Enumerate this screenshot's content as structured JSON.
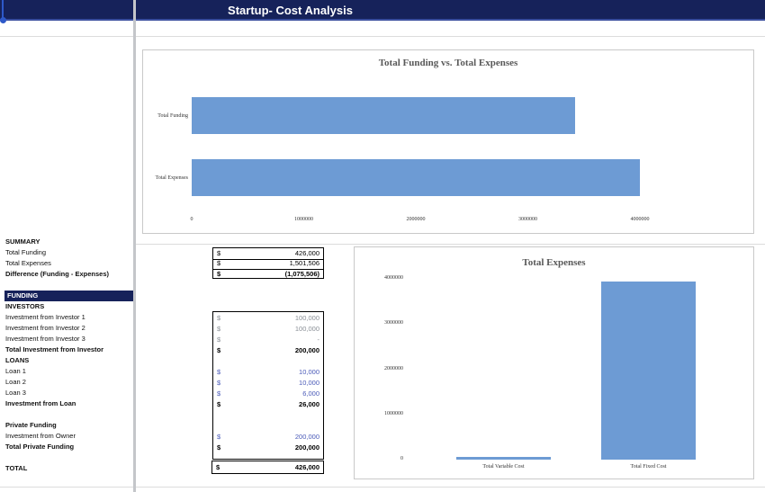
{
  "header": {
    "title": "Startup- Cost Analysis"
  },
  "colors": {
    "navy": "#16225a",
    "accent_line": "#3a4e9d",
    "bar_blue": "#6d9bd4",
    "input_blue": "#4a5ab8",
    "muted_gray": "#8a8f96",
    "chart_title_gray": "#595959",
    "border_gray": "#c9c9c9",
    "selection_blue": "#2e59c9"
  },
  "sidebar": {
    "rows": [
      {
        "label": "SUMMARY",
        "style": "section"
      },
      {
        "label": "Total Funding",
        "style": "item"
      },
      {
        "label": "Total Expenses",
        "style": "item"
      },
      {
        "label": "Difference (Funding - Expenses)",
        "style": "section"
      },
      {
        "label": "",
        "style": "blank"
      },
      {
        "label": "FUNDING",
        "style": "banner"
      },
      {
        "label": "INVESTORS",
        "style": "section"
      },
      {
        "label": "Investment from Investor 1",
        "style": "item"
      },
      {
        "label": "Investment from Investor 2",
        "style": "item"
      },
      {
        "label": "Investment from Investor 3",
        "style": "item"
      },
      {
        "label": "Total Investment from Investor",
        "style": "section"
      },
      {
        "label": "LOANS",
        "style": "section"
      },
      {
        "label": "Loan 1",
        "style": "item"
      },
      {
        "label": "Loan 2",
        "style": "item"
      },
      {
        "label": "Loan 3",
        "style": "item"
      },
      {
        "label": "Investment from Loan",
        "style": "section"
      },
      {
        "label": "",
        "style": "blank"
      },
      {
        "label": "Private Funding",
        "style": "section"
      },
      {
        "label": "Investment from Owner",
        "style": "item"
      },
      {
        "label": "Total Private Funding",
        "style": "section"
      },
      {
        "label": "",
        "style": "blank"
      },
      {
        "label": "TOTAL",
        "style": "section"
      }
    ]
  },
  "summary_box": {
    "rows": [
      {
        "currency": "$",
        "value": "426,000",
        "style": "sep"
      },
      {
        "currency": "$",
        "value": "1,501,506",
        "style": "sep"
      },
      {
        "currency": "$",
        "value": "(1,075,506)",
        "style": "bold topline"
      }
    ]
  },
  "funding_box": {
    "rows": [
      {
        "currency": "$",
        "value": "100,000",
        "style": "gray"
      },
      {
        "currency": "$",
        "value": "100,000",
        "style": "gray"
      },
      {
        "currency": "$",
        "value": "-",
        "style": "gray"
      },
      {
        "currency": "$",
        "value": "200,000",
        "style": "bold"
      },
      {
        "style": "blank"
      },
      {
        "currency": "$",
        "value": "10,000",
        "style": "blue"
      },
      {
        "currency": "$",
        "value": "10,000",
        "style": "blue"
      },
      {
        "currency": "$",
        "value": "6,000",
        "style": "blue"
      },
      {
        "currency": "$",
        "value": "26,000",
        "style": "bold"
      },
      {
        "style": "blank"
      },
      {
        "style": "blank"
      },
      {
        "currency": "$",
        "value": "200,000",
        "style": "blue"
      },
      {
        "currency": "$",
        "value": "200,000",
        "style": "bold"
      },
      {
        "style": "blank"
      }
    ]
  },
  "total_box": {
    "row": {
      "currency": "$",
      "value": "426,000"
    }
  },
  "chart_data": [
    {
      "type": "bar",
      "orientation": "horizontal",
      "title": "Total Funding vs. Total Expenses",
      "categories": [
        "Total Funding",
        "Total Expenses"
      ],
      "values": [
        3420000,
        4000000
      ],
      "xticks": [
        0,
        1000000,
        2000000,
        3000000,
        4000000
      ],
      "xlim": [
        0,
        4700000
      ],
      "grid": false,
      "legend": false,
      "bar_color": "#6d9bd4"
    },
    {
      "type": "bar",
      "orientation": "vertical",
      "title": "Total Expenses",
      "categories": [
        "Total Variable Cost",
        "Total Fixed Cost"
      ],
      "values": [
        60000,
        3950000
      ],
      "yticks": [
        0,
        1000000,
        2000000,
        3000000,
        4000000
      ],
      "ylim": [
        0,
        4200000
      ],
      "grid": false,
      "legend": false,
      "bar_color": "#6d9bd4"
    }
  ]
}
